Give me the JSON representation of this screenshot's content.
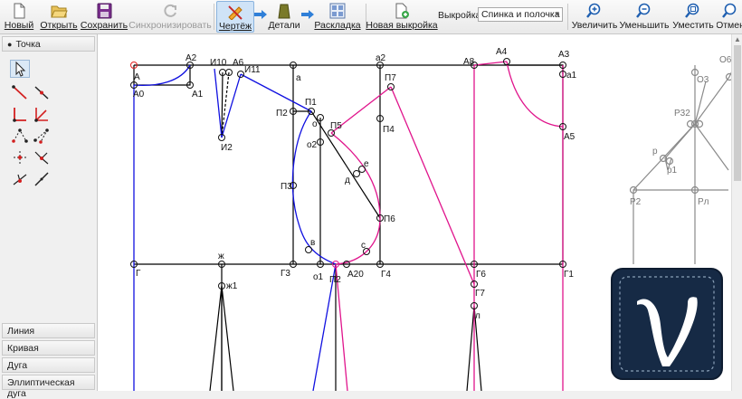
{
  "toolbar": {
    "new": "Новый",
    "open": "Открыть",
    "save": "Сохранить",
    "sync": "Синхронизировать",
    "draft": "Чертёж",
    "details": "Детали",
    "layout": "Раскладка",
    "new_pattern": "Новая выкройка",
    "pattern_label": "Выкройка:",
    "pattern_value": "Спинка и полочка",
    "zoom_in": "Увеличить",
    "zoom_out": "Уменьшить",
    "fit": "Уместить",
    "cancel": "Отмен"
  },
  "tools": {
    "point_section": "Точка",
    "line_section": "Линия",
    "curve_section": "Кривая",
    "arc_section": "Дуга",
    "ellipse_section": "Эллиптическая дуга"
  },
  "drawing": {
    "labels": [
      "A",
      "A0",
      "A1",
      "A2",
      "И10",
      "A6",
      "И11",
      "И2",
      "a",
      "a2",
      "A8",
      "A4",
      "A3",
      "a1",
      "П1",
      "П2",
      "о",
      "о2",
      "П5",
      "П7",
      "П4",
      "е",
      "д",
      "П6",
      "П3",
      "в",
      "с",
      "Г",
      "ж",
      "ж1",
      "Г3",
      "о1",
      "П2",
      "A20",
      "Г4",
      "Г6",
      "Г7",
      "л",
      "Г1",
      "A5"
    ],
    "labels_ref": [
      "О6",
      "О3",
      "Р32",
      "р",
      "р1",
      "Р2",
      "Рл"
    ],
    "colors": {
      "base": "#000000",
      "back": "#1010e0",
      "front": "#e0148c",
      "reference": "#8a8a8a"
    }
  }
}
